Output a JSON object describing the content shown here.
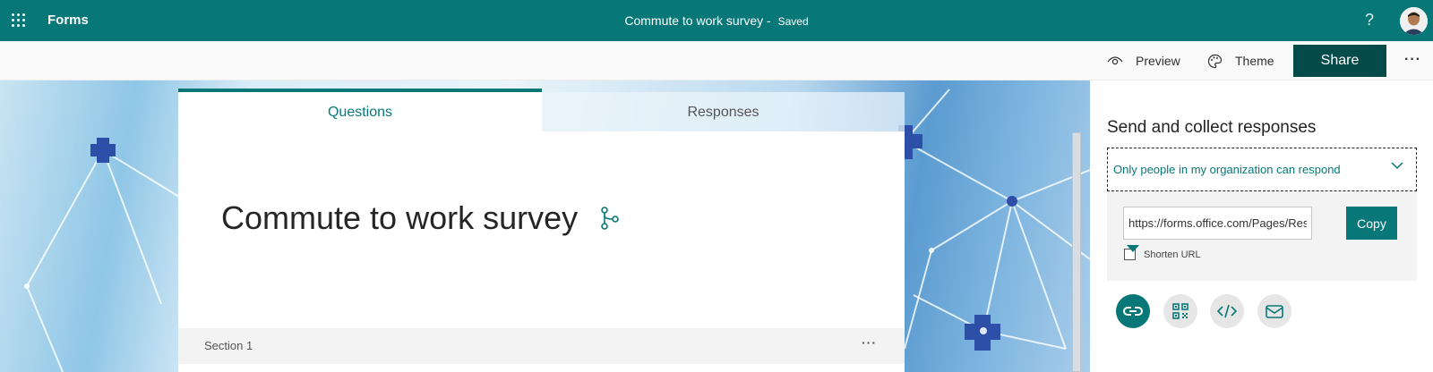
{
  "app": {
    "name": "Forms",
    "document_title": "Commute to work survey",
    "save_status": "Saved",
    "help_label": "?"
  },
  "toolbar": {
    "preview_label": "Preview",
    "theme_label": "Theme",
    "share_label": "Share",
    "more_label": "···"
  },
  "form": {
    "tabs": [
      {
        "label": "Questions",
        "active": true
      },
      {
        "label": "Responses",
        "active": false
      }
    ],
    "title": "Commute to work survey",
    "section_label": "Section 1",
    "section_more_label": "···"
  },
  "share_panel": {
    "title": "Send and collect responses",
    "audience_selected": "Only people in my organization can respond",
    "url_value": "https://forms.office.com/Pages/ResponsePage.aspx",
    "copy_label": "Copy",
    "shorten_url_label": "Shorten URL",
    "shorten_url_checked": false,
    "share_options": [
      {
        "icon": "link-icon",
        "active": true
      },
      {
        "icon": "qr-code-icon",
        "active": false
      },
      {
        "icon": "embed-icon",
        "active": false
      },
      {
        "icon": "email-icon",
        "active": false
      }
    ]
  },
  "colors": {
    "brand": "#077877",
    "share_button": "#044b4a",
    "accent_link": "#077877"
  }
}
